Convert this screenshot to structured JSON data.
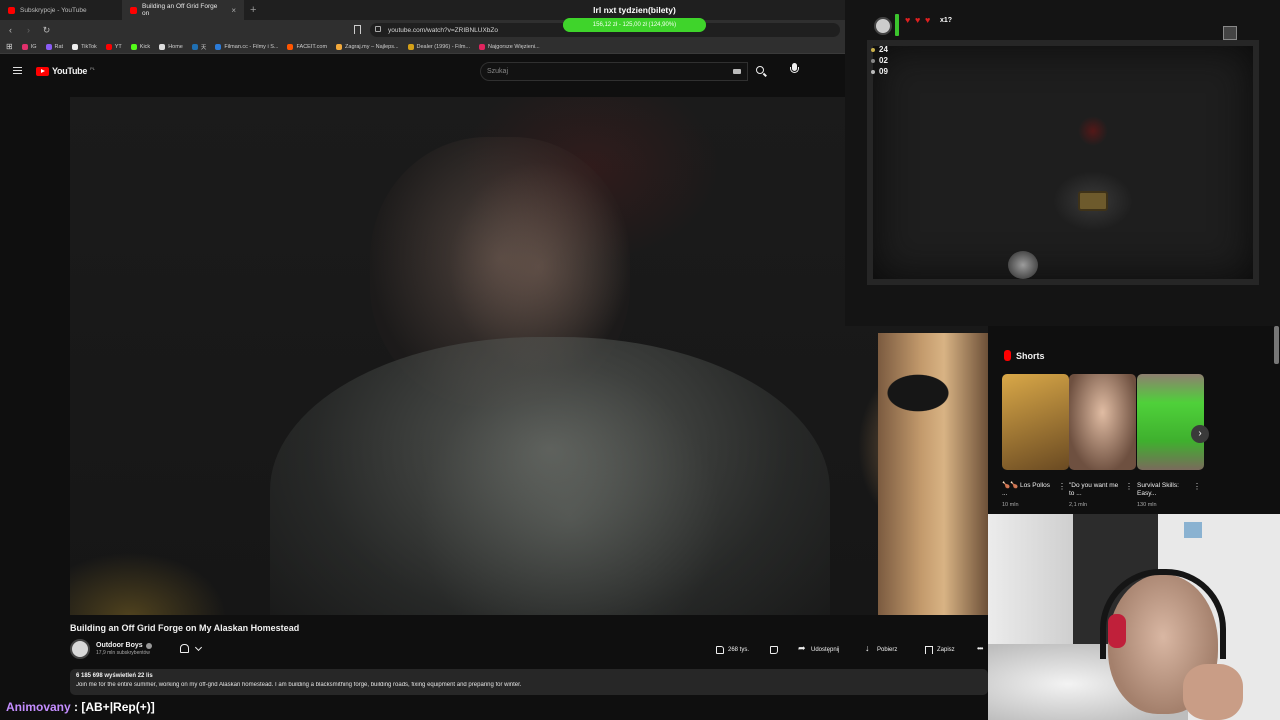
{
  "browser": {
    "tabs": [
      {
        "label": "Subskrypcje - YouTube",
        "active": false
      },
      {
        "label": "Building an Off Grid Forge on",
        "active": true
      }
    ],
    "url": "youtube.com/watch?v=ZRIBNLUXbZo",
    "bookmarks": [
      {
        "label": "IG",
        "color": "#e1306c"
      },
      {
        "label": "Rat",
        "color": "#8a5cf6"
      },
      {
        "label": "TikTok",
        "color": "#111111"
      },
      {
        "label": "YT",
        "color": "#ff0000"
      },
      {
        "label": "Kick",
        "color": "#53fc18"
      },
      {
        "label": "Home",
        "color": "#1d1d1d"
      },
      {
        "label": "天",
        "color": "#1f6fb2"
      },
      {
        "label": "Filman.cc - Filmy i S...",
        "color": "#2b7bd8"
      },
      {
        "label": "FACEIT.com",
        "color": "#ff5500"
      },
      {
        "label": "Zagraj.my – Najleps...",
        "color": "#f2a93b"
      },
      {
        "label": "Dealer (1996) - Film...",
        "color": "#d4a017"
      },
      {
        "label": "Najgorsze Więzieni...",
        "color": "#e0245e"
      }
    ]
  },
  "donation_goal": {
    "title": "lrl nxt tydzien(bilety)",
    "progress_text": "156,12 zł - 125,00 zł (124,90%)",
    "progress_fraction": 1.0
  },
  "youtube": {
    "logo": "YouTube",
    "region": "PL",
    "search_placeholder": "Szukaj",
    "video_title": "Building an Off Grid Forge on My Alaskan Homestead",
    "channel_name": "Outdoor Boys",
    "channel_subs": "17,9 mln subskrybentów",
    "likes": "268 tys.",
    "share_label": "Udostępnij",
    "download_label": "Pobierz",
    "save_label": "Zapisz",
    "desc_stats": "6 185 698 wyświetleń  22 lis",
    "desc_text": "Join me for the entire summer, working on my off-grid Alaskan homestead. I am building a blacksmithing forge, building roads, fixing equipment and preparing for winter."
  },
  "shorts": {
    "title": "Shorts",
    "items": [
      {
        "caption": "🍗🍗 Los Pollos ...",
        "views": "10 mln",
        "colors": [
          "#c8962f",
          "#5b3b1c"
        ]
      },
      {
        "caption": "\"Do you want me to ...",
        "views": "2,1 mln",
        "colors": [
          "#d6ae95",
          "#7a5a48"
        ]
      },
      {
        "caption": "Survival Skills: Easy...",
        "views": "130 mln",
        "colors": [
          "#4fd13a",
          "#8a7a6a"
        ]
      }
    ]
  },
  "game_hud": {
    "multiplier": "x1?",
    "hearts": 3,
    "coins": "24",
    "bombs": "02",
    "keys": "09"
  },
  "chat": {
    "user": "Animovany",
    "message": " : [AB+|Rep(+)]"
  }
}
